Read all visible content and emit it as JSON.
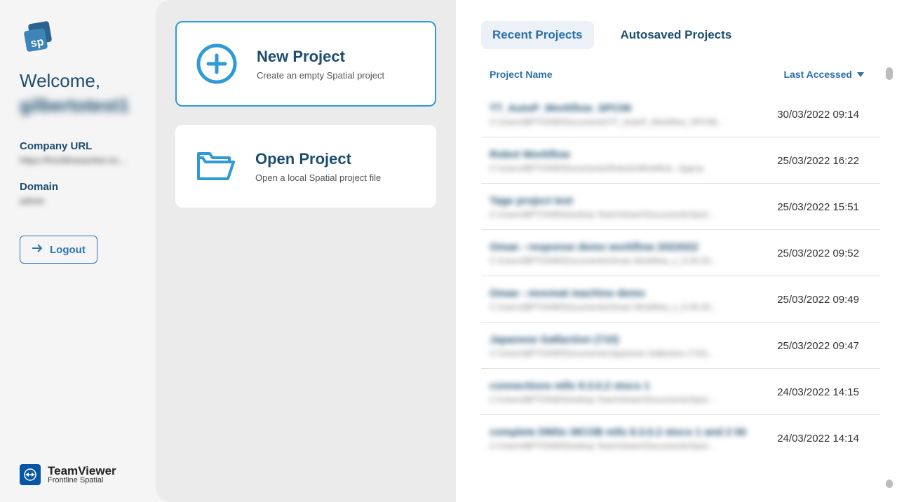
{
  "sidebar": {
    "welcome": "Welcome,",
    "username": "gilbertotest1",
    "company_url_label": "Company URL",
    "company_url_value": "https://frontlineworker.ex...",
    "domain_label": "Domain",
    "domain_value": "admin",
    "logout": "Logout",
    "footer_main": "TeamViewer",
    "footer_sub": "Frontline Spatial"
  },
  "actions": {
    "new_project": {
      "title": "New Project",
      "subtitle": "Create an empty Spatial project"
    },
    "open_project": {
      "title": "Open Project",
      "subtitle": "Open a local Spatial project file"
    }
  },
  "tabs": {
    "recent": "Recent Projects",
    "autosaved": "Autosaved Projects"
  },
  "columns": {
    "name": "Project Name",
    "date": "Last Accessed"
  },
  "projects": [
    {
      "name": "TT_AutoP_Workflow_SPC06",
      "path": "C:\\Users\\BPTO040\\Documents\\TT_AutoP_Workflow_SPC06...",
      "date": "30/03/2022 09:14"
    },
    {
      "name": "Robot Workflow",
      "path": "C:\\Users\\BPTO040\\Documents\\Robots\\Workflow...Spproj",
      "date": "25/03/2022 16:22"
    },
    {
      "name": "Tage project test",
      "path": "C:\\Users\\BPTO040\\Desktop   TeamViewer\\Documents\\Spot...",
      "date": "25/03/2022 15:51"
    },
    {
      "name": "Omae - response demo workflow 2022022",
      "path": "C:\\Users\\BPTO040\\Documents\\Omae   Workflow_v_5.00.20...",
      "date": "25/03/2022 09:52"
    },
    {
      "name": "Omae - movmat machine demo",
      "path": "C:\\Users\\BPTO040\\Documents\\Omae   Workflow_v_5.00.20...",
      "date": "date5"
    },
    {
      "name": "Japanese   Gallaction (710)",
      "path": "C:\\Users\\BPTO040\\Documents\\Japanese   Gallaction (710)...",
      "date": "date6"
    },
    {
      "name": "connections   mlls 9.3.0.2   stocs 1",
      "path": "C:\\Users\\BPTO040\\Desktop   TeamViewer\\Documents\\Spot...",
      "date": "date7"
    },
    {
      "name": "complete DMSc MCOB   mlls 9.3.0.2   stocs 1 and 2 06",
      "path": "C:\\Users\\BPTO040\\Desktop   TeamViewer\\Documents\\Spot...",
      "date": "date8"
    }
  ],
  "dates": {
    "date5": "25/03/2022 09:49",
    "date6": "25/03/2022 09:47",
    "date7": "24/03/2022 14:15",
    "date8": "24/03/2022 14:14"
  }
}
